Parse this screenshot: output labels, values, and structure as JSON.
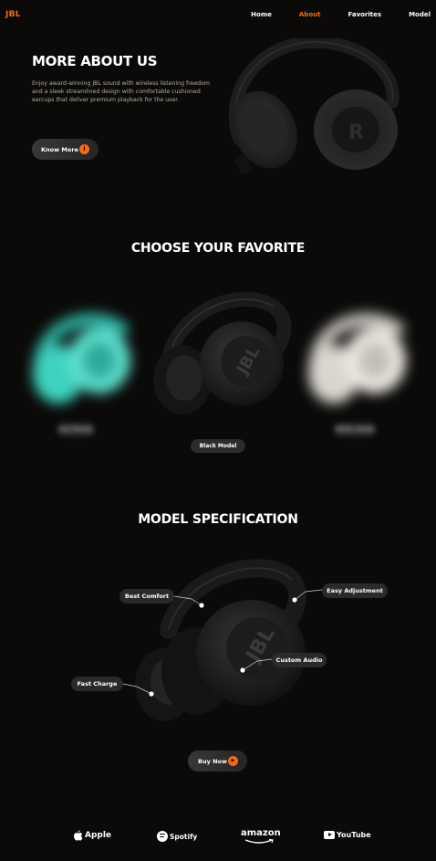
{
  "brand": {
    "logo": "JBL"
  },
  "nav": {
    "home": "Home",
    "about": "About",
    "favorites": "Favorites",
    "model": "Model",
    "active": "About",
    "active_color": "#f26a21"
  },
  "about": {
    "title": "MORE ABOUT US",
    "text": "Enjoy award-winning JBL sound with wireless listening freedom and a sleek streamlined design with comfortable cushioned earcups that deliver premium playback for the user.",
    "button": "Know More",
    "button_icon": "info-icon"
  },
  "choose": {
    "title": "CHOOSE YOUR FAVORITE",
    "models": [
      {
        "label": "Teal Model",
        "color": "#3fd2c0",
        "selected": false
      },
      {
        "label": "Black Model",
        "color": "#1c1c1c",
        "selected": true
      },
      {
        "label": "White Model",
        "color": "#e6e3dc",
        "selected": false
      }
    ]
  },
  "spec": {
    "title": "MODEL SPECIFICATION",
    "features": {
      "comfort": "Best Comfort",
      "adjust": "Easy Adjustment",
      "audio": "Custom Audio",
      "charge": "Fast Charge"
    },
    "button": "Buy Now",
    "button_icon": "play-icon"
  },
  "brands": {
    "apple": "Apple",
    "spotify": "Spotify",
    "amazon": "amazon",
    "youtube": "YouTube"
  },
  "colors": {
    "accent": "#f26a21",
    "background": "#0b0a09"
  }
}
